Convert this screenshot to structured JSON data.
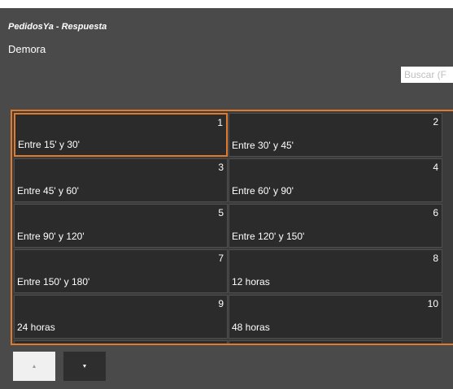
{
  "header": {
    "title": "PedidosYa - Respuesta",
    "subtitle": "Demora"
  },
  "search": {
    "placeholder": "Buscar (F"
  },
  "tiles": [
    {
      "num": "1",
      "label": "Entre 15' y 30'"
    },
    {
      "num": "2",
      "label": "Entre 30' y 45'"
    },
    {
      "num": "3",
      "label": "Entre 45' y 60'"
    },
    {
      "num": "4",
      "label": "Entre 60' y 90'"
    },
    {
      "num": "5",
      "label": "Entre 90' y 120'"
    },
    {
      "num": "6",
      "label": "Entre 120' y 150'"
    },
    {
      "num": "7",
      "label": "Entre 150' y 180'"
    },
    {
      "num": "8",
      "label": "12 horas"
    },
    {
      "num": "9",
      "label": "24 horas"
    },
    {
      "num": "10",
      "label": "48 horas"
    }
  ],
  "selected_tile": "1",
  "colors": {
    "accent": "#e07a2d",
    "background": "#4a4a4a",
    "tile": "#2b2b2b"
  },
  "nav": {
    "up_icon": "arrow-up-icon",
    "down_icon": "arrow-down-icon"
  }
}
